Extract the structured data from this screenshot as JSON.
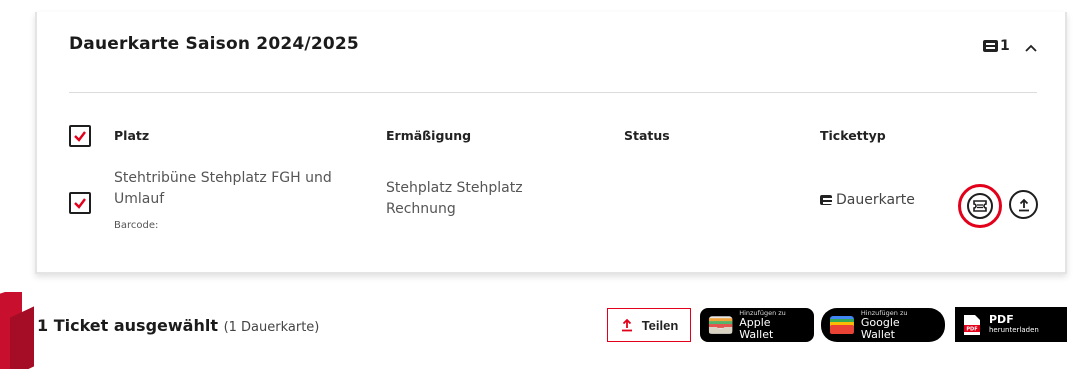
{
  "card": {
    "title": "Dauerkarte Saison 2024/2025",
    "ticket_count": "1",
    "columns": [
      "Platz",
      "Ermäßigung",
      "Status",
      "Tickettyp"
    ],
    "row": {
      "seat_line1": "Stehtribüne Stehplatz FGH und",
      "seat_line2": "Umlauf",
      "barcode_label": "Barcode:",
      "discount_line1": "Stehplatz Stehplatz",
      "discount_line2": "Rechnung",
      "status": "",
      "ticket_type": "Dauerkarte"
    }
  },
  "footer": {
    "summary": "1 Ticket ausgewählt",
    "summary_detail": "(1 Dauerkarte)",
    "share_label": "Teilen",
    "apple_small": "Hinzufügen zu",
    "apple_big": "Apple Wallet",
    "google_small": "Hinzufügen zu",
    "google_big": "Google Wallet",
    "pdf_big": "PDF",
    "pdf_small": "herunterladen",
    "pdf_icon_text": "PDF"
  },
  "colors": {
    "accent": "#e2001a",
    "text": "#222222",
    "muted": "#555555"
  },
  "icons": [
    "ticket-icon",
    "chevron-up-icon",
    "checkmark-icon",
    "upload-icon",
    "wallet-icon",
    "pdf-icon"
  ]
}
